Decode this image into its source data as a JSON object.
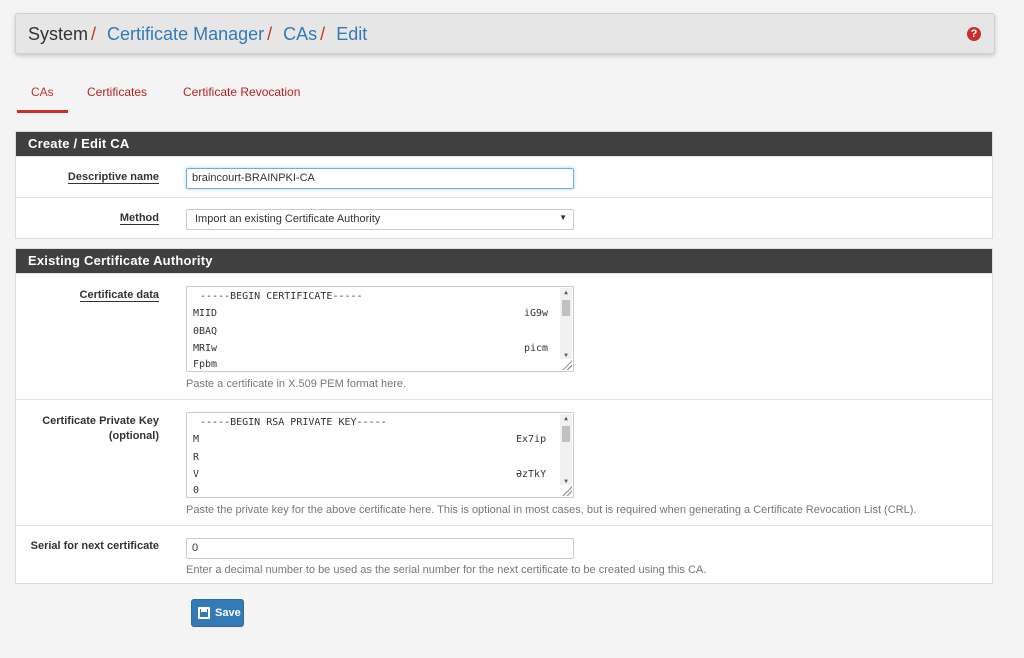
{
  "breadcrumb": {
    "root": "System",
    "items": [
      "Certificate Manager",
      "CAs",
      "Edit"
    ]
  },
  "help_icon": "question-icon",
  "tabs": [
    {
      "label": "CAs",
      "active": true
    },
    {
      "label": "Certificates",
      "active": false
    },
    {
      "label": "Certificate Revocation",
      "active": false
    }
  ],
  "panel_create": {
    "heading": "Create / Edit CA",
    "descriptive_name": {
      "label": "Descriptive name",
      "value": "braincourt-BRAINPKI-CA"
    },
    "method": {
      "label": "Method",
      "value": "Import an existing Certificate Authority"
    }
  },
  "panel_existing": {
    "heading": "Existing Certificate Authority",
    "cert_data": {
      "label": "Certificate data",
      "lines": [
        "-----BEGIN CERTIFICATE-----",
        "MIID",
        "0BAQ",
        "MRIw",
        "Fpbm"
      ],
      "right": [
        "iG9w",
        "picm"
      ],
      "help": "Paste a certificate in X.509 PEM format here."
    },
    "private_key": {
      "label_1": "Certificate Private Key",
      "label_2": "(optional)",
      "lines": [
        "-----BEGIN RSA PRIVATE KEY-----",
        "M",
        "R",
        "V",
        "0"
      ],
      "right": [
        "Ex7ip",
        "ƏzTkY"
      ],
      "help": "Paste the private key for the above certificate here. This is optional in most cases, but is required when generating a Certificate Revocation List (CRL)."
    },
    "serial": {
      "label": "Serial for next certificate",
      "value": "0",
      "help": "Enter a decimal number to be used as the serial number for the next certificate to be created using this CA."
    }
  },
  "save_label": "Save",
  "colors": {
    "accent": "#c9302c",
    "primary": "#337ab7",
    "heading_bg": "#404040"
  }
}
